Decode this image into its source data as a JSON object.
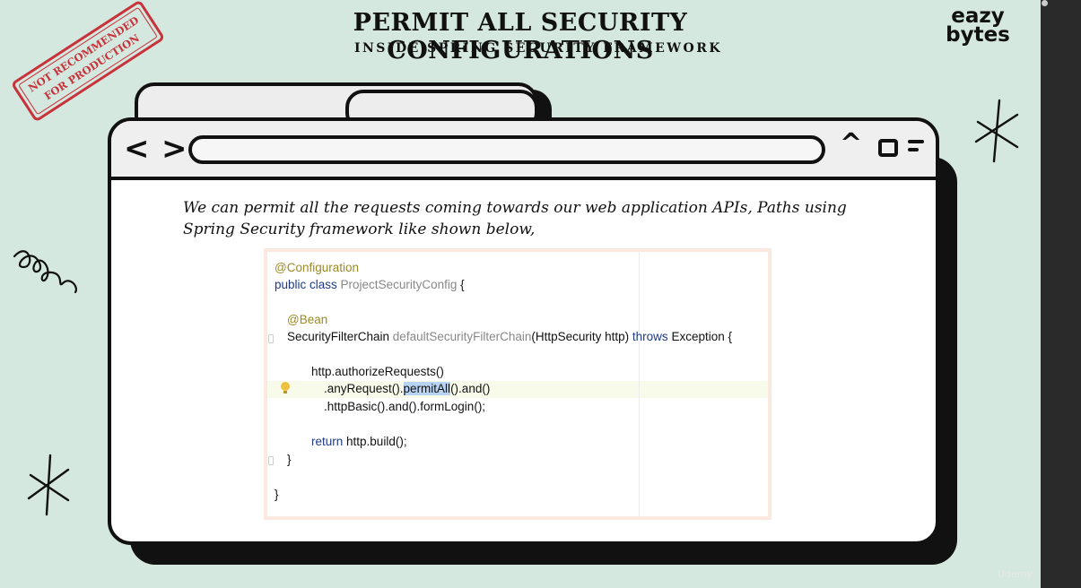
{
  "slide": {
    "title": "PERMIT ALL SECURITY CONFIGURATIONS",
    "subtitle": "INSIDE SPRING SECURITY FRAMEWORK",
    "logo_line1": "eazy",
    "logo_line2": "bytes",
    "stamp_line1": "NOT RECOMMENDED",
    "stamp_line2": "FOR PRODUCTION",
    "description": "We can permit all the requests coming towards our web application APIs, Paths using Spring Security framework like shown below,"
  },
  "browser": {
    "back_glyph": "<",
    "forward_glyph": ">",
    "caret_glyph": "^"
  },
  "code": {
    "l1": "@Configuration",
    "l2_kw": "public class",
    "l2_name": "ProjectSecurityConfig",
    "l2_end": " {",
    "l3": "@Bean",
    "l4_type": "SecurityFilterChain ",
    "l4_method": "defaultSecurityFilterChain",
    "l4_params": "(HttpSecurity http) ",
    "l4_throws": "throws",
    "l4_end": " Exception {",
    "l5": "http.authorizeRequests()",
    "l6_a": ".anyRequest().",
    "l6_sel": "permitAll",
    "l6_b": "().and()",
    "l7": ".httpBasic().and().formLogin();",
    "l8_kw": "return",
    "l8_rest": " http.build();",
    "l9": "}",
    "l10": "}"
  },
  "watermark": "Udemy",
  "icons": [
    "back-arrow-icon",
    "forward-arrow-icon",
    "caret-up-icon",
    "window-box-icon",
    "menu-lines-icon",
    "lightbulb-icon",
    "squiggle-doodle-icon",
    "star-doodle-icon"
  ],
  "colors": {
    "background": "#d5e8df",
    "stamp": "#c8333b",
    "keyword": "#1e3a8a",
    "annotation": "#9b8a25",
    "selection": "#b8d4f5"
  }
}
